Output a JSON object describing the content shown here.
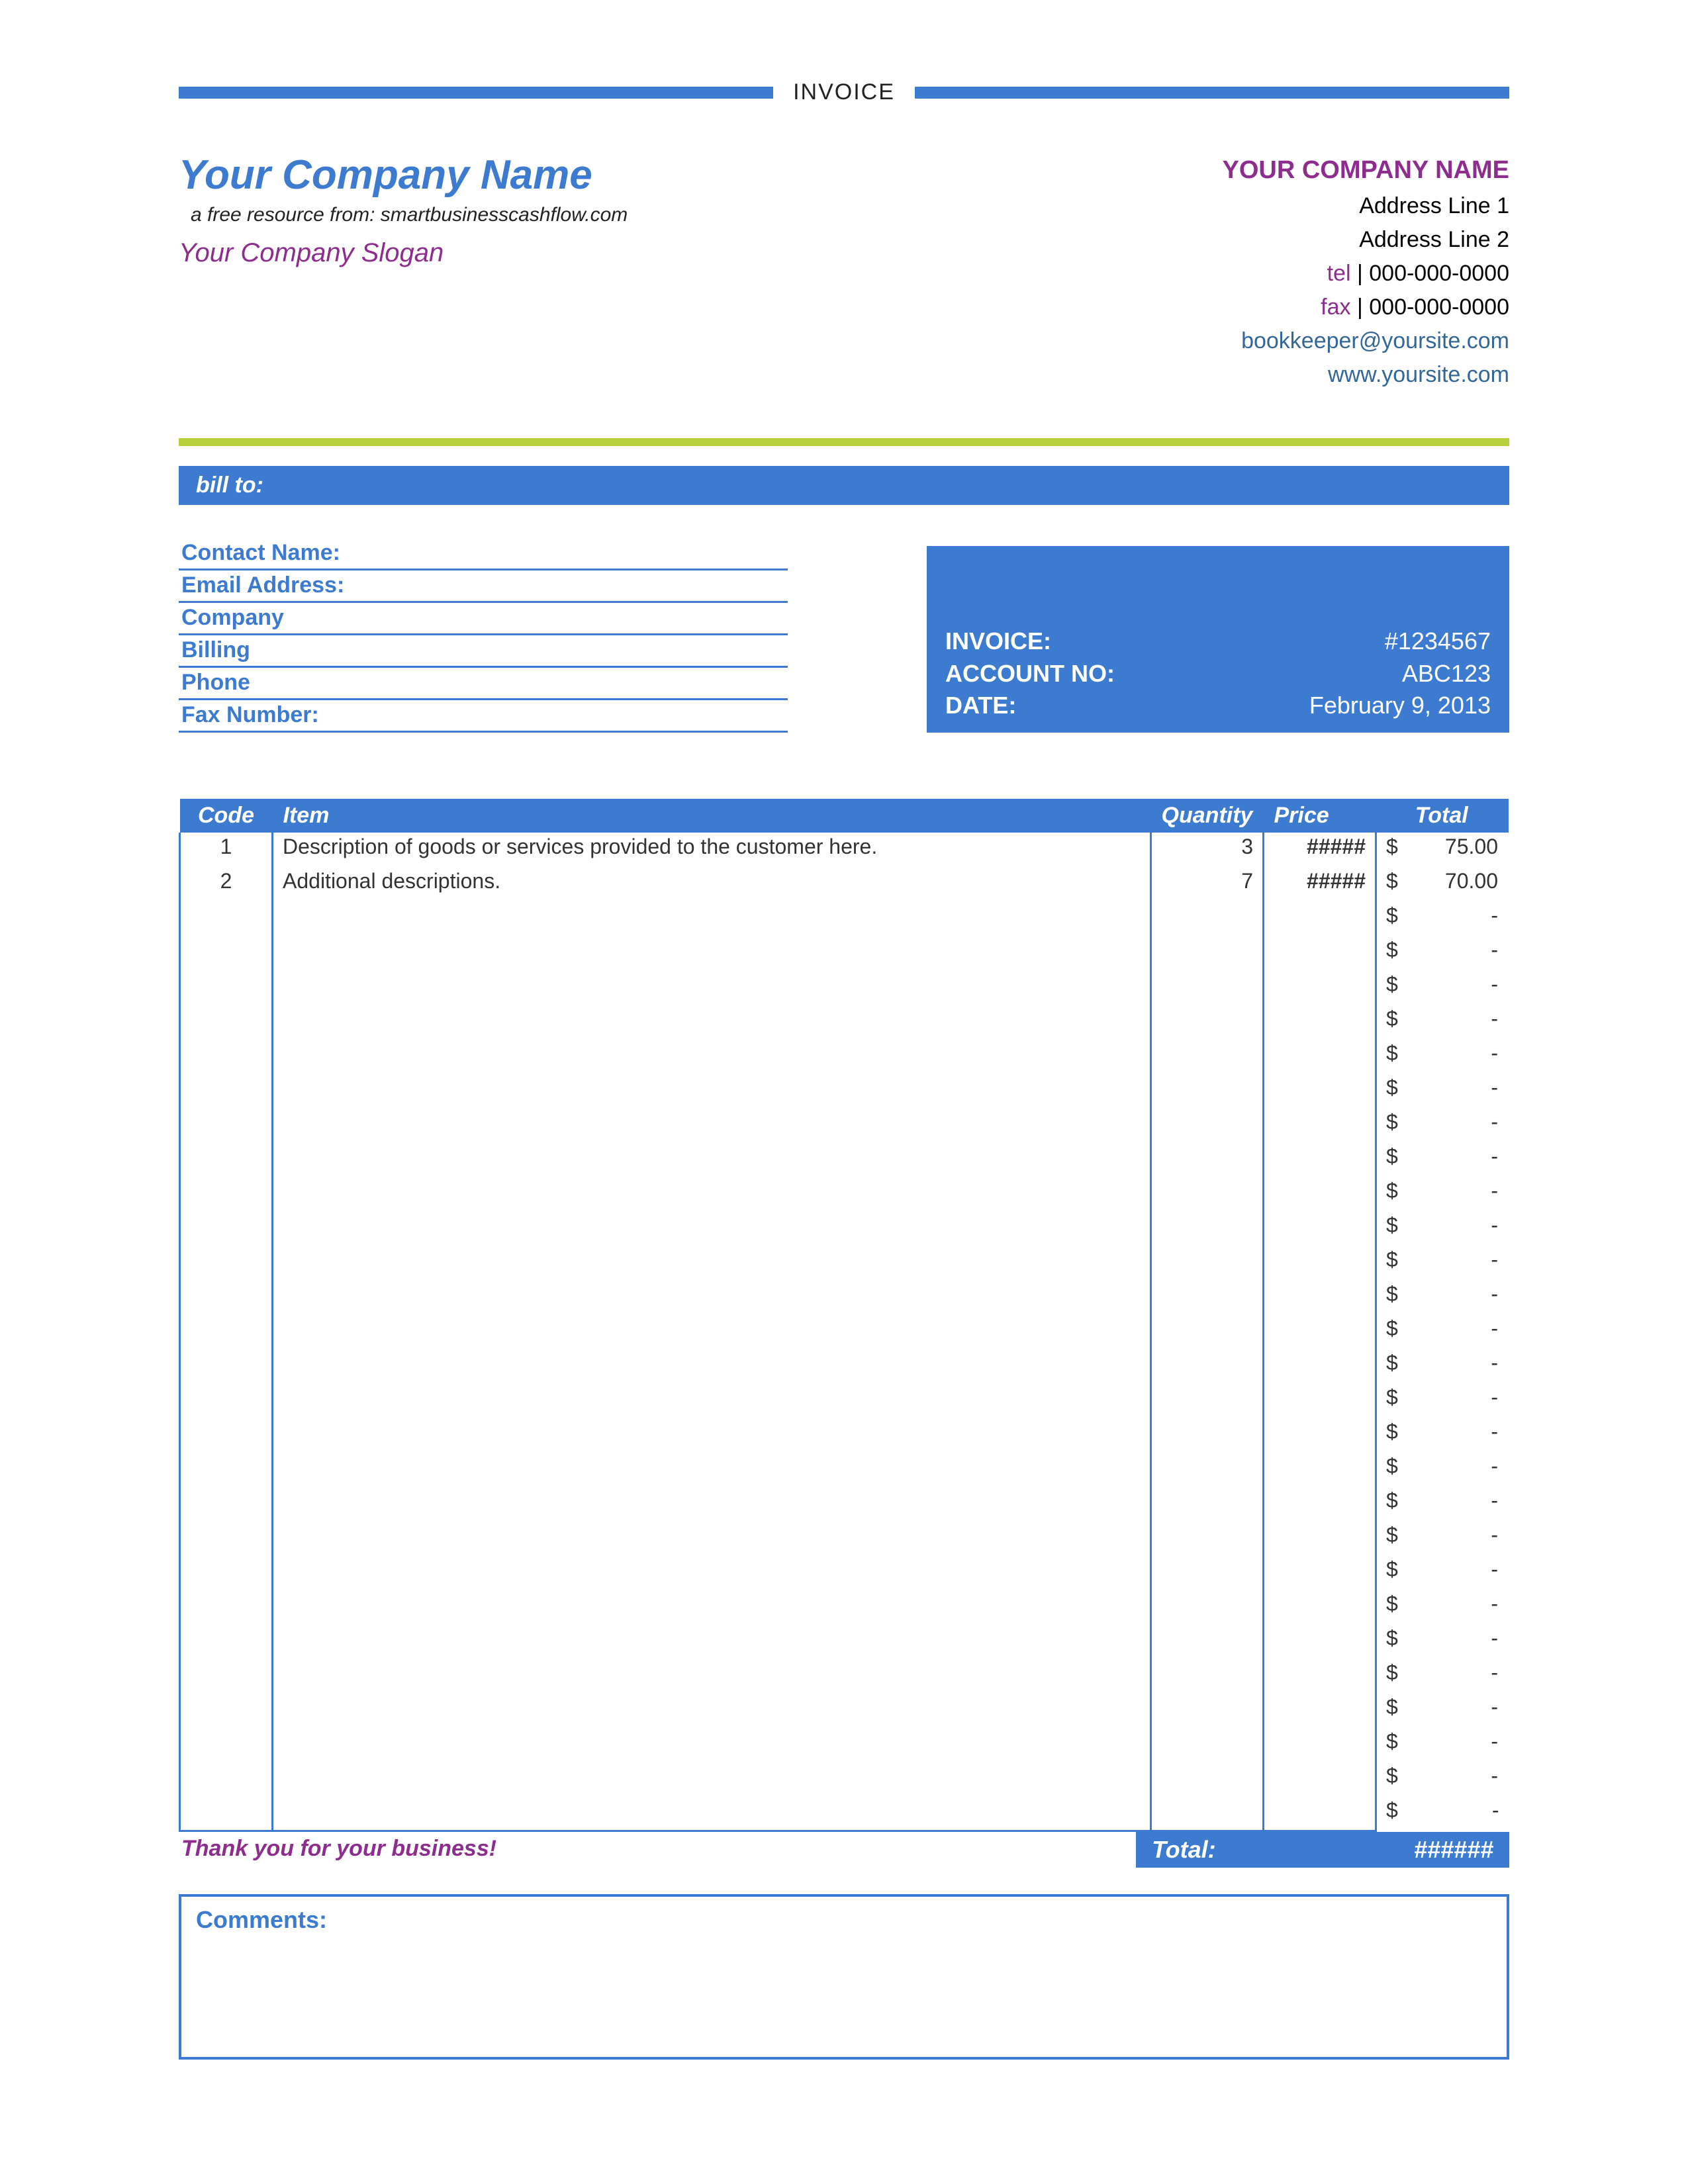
{
  "title": "INVOICE",
  "header": {
    "company_name": "Your Company Name",
    "resource_line": "a free resource from: smartbusinesscashflow.com",
    "slogan": "Your Company Slogan",
    "right_company": "YOUR COMPANY NAME",
    "addr1": "Address Line 1",
    "addr2": "Address Line 2",
    "tel_label": "tel",
    "tel": "000-000-0000",
    "fax_label": "fax",
    "fax": "000-000-0000",
    "email": "bookkeeper@yoursite.com",
    "website": "www.yoursite.com"
  },
  "billto_label": "bill to:",
  "contact_fields": [
    "Contact Name:",
    "Email Address:",
    "Company",
    "Billing",
    "Phone",
    "Fax Number:"
  ],
  "invoice_meta": {
    "invoice_label": "INVOICE:",
    "invoice_no": "#1234567",
    "account_label": "ACCOUNT NO:",
    "account_no": "ABC123",
    "date_label": "DATE:",
    "date": "February 9, 2013"
  },
  "columns": {
    "code": "Code",
    "item": "Item",
    "qty": "Quantity",
    "price": "Price",
    "total": "Total"
  },
  "currency": "$",
  "items": [
    {
      "code": "1",
      "item": "Description of goods or services provided to the customer here.",
      "qty": "3",
      "price": "#####",
      "total": "75.00"
    },
    {
      "code": "2",
      "item": "Additional descriptions.",
      "qty": "7",
      "price": "#####",
      "total": "70.00"
    },
    {
      "code": "",
      "item": "",
      "qty": "",
      "price": "",
      "total": "-"
    },
    {
      "code": "",
      "item": "",
      "qty": "",
      "price": "",
      "total": "-"
    },
    {
      "code": "",
      "item": "",
      "qty": "",
      "price": "",
      "total": "-"
    },
    {
      "code": "",
      "item": "",
      "qty": "",
      "price": "",
      "total": "-"
    },
    {
      "code": "",
      "item": "",
      "qty": "",
      "price": "",
      "total": "-"
    },
    {
      "code": "",
      "item": "",
      "qty": "",
      "price": "",
      "total": "-"
    },
    {
      "code": "",
      "item": "",
      "qty": "",
      "price": "",
      "total": "-"
    },
    {
      "code": "",
      "item": "",
      "qty": "",
      "price": "",
      "total": "-"
    },
    {
      "code": "",
      "item": "",
      "qty": "",
      "price": "",
      "total": "-"
    },
    {
      "code": "",
      "item": "",
      "qty": "",
      "price": "",
      "total": "-"
    },
    {
      "code": "",
      "item": "",
      "qty": "",
      "price": "",
      "total": "-"
    },
    {
      "code": "",
      "item": "",
      "qty": "",
      "price": "",
      "total": "-"
    },
    {
      "code": "",
      "item": "",
      "qty": "",
      "price": "",
      "total": "-"
    },
    {
      "code": "",
      "item": "",
      "qty": "",
      "price": "",
      "total": "-"
    },
    {
      "code": "",
      "item": "",
      "qty": "",
      "price": "",
      "total": "-"
    },
    {
      "code": "",
      "item": "",
      "qty": "",
      "price": "",
      "total": "-"
    },
    {
      "code": "",
      "item": "",
      "qty": "",
      "price": "",
      "total": "-"
    },
    {
      "code": "",
      "item": "",
      "qty": "",
      "price": "",
      "total": "-"
    },
    {
      "code": "",
      "item": "",
      "qty": "",
      "price": "",
      "total": "-"
    },
    {
      "code": "",
      "item": "",
      "qty": "",
      "price": "",
      "total": "-"
    },
    {
      "code": "",
      "item": "",
      "qty": "",
      "price": "",
      "total": "-"
    },
    {
      "code": "",
      "item": "",
      "qty": "",
      "price": "",
      "total": "-"
    },
    {
      "code": "",
      "item": "",
      "qty": "",
      "price": "",
      "total": "-"
    },
    {
      "code": "",
      "item": "",
      "qty": "",
      "price": "",
      "total": "-"
    },
    {
      "code": "",
      "item": "",
      "qty": "",
      "price": "",
      "total": "-"
    },
    {
      "code": "",
      "item": "",
      "qty": "",
      "price": "",
      "total": "-"
    },
    {
      "code": "",
      "item": "",
      "qty": "",
      "price": "",
      "total": "-"
    }
  ],
  "thanks": "Thank you for your business!",
  "grand_total_label": "Total:",
  "grand_total_value": "######",
  "comments_label": "Comments:"
}
